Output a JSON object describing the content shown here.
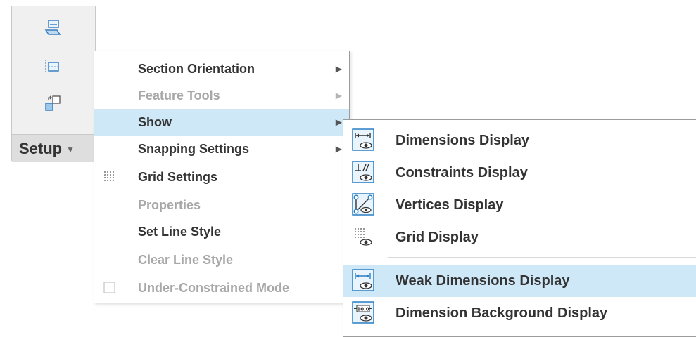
{
  "ribbon": {
    "group_label": "Setup",
    "buttons": [
      "sketch-plane-icon",
      "sketch-view-icon",
      "reference-icon"
    ]
  },
  "menu": {
    "items": [
      {
        "label": "Section Orientation",
        "enabled": true,
        "submenu": true
      },
      {
        "label": "Feature Tools",
        "enabled": false,
        "submenu": true
      },
      {
        "label": "Show",
        "enabled": true,
        "submenu": true,
        "highlighted": true
      },
      {
        "label": "Snapping Settings",
        "enabled": true,
        "submenu": true
      },
      {
        "label": "Grid Settings",
        "enabled": true,
        "icon": "grid-dots-icon"
      },
      {
        "label": "Properties",
        "enabled": false
      },
      {
        "label": "Set Line Style",
        "enabled": true
      },
      {
        "label": "Clear Line Style",
        "enabled": false
      },
      {
        "label": "Under-Constrained Mode",
        "enabled": false,
        "icon": "checkbox-icon"
      }
    ]
  },
  "submenu": {
    "items": [
      {
        "label": "Dimensions Display",
        "icon": "dimensions-display-icon"
      },
      {
        "label": "Constraints Display",
        "icon": "constraints-display-icon"
      },
      {
        "label": "Vertices Display",
        "icon": "vertices-display-icon"
      },
      {
        "label": "Grid Display",
        "icon": "grid-display-icon"
      },
      {
        "label": "Weak Dimensions Display",
        "icon": "weak-dimensions-display-icon",
        "highlighted": true
      },
      {
        "label": "Dimension Background Display",
        "icon": "dimension-background-display-icon"
      }
    ]
  },
  "colors": {
    "highlight": "#cfe8f8",
    "disabled_text": "#a7a7a7",
    "icon_blue": "#2a7fc4"
  }
}
